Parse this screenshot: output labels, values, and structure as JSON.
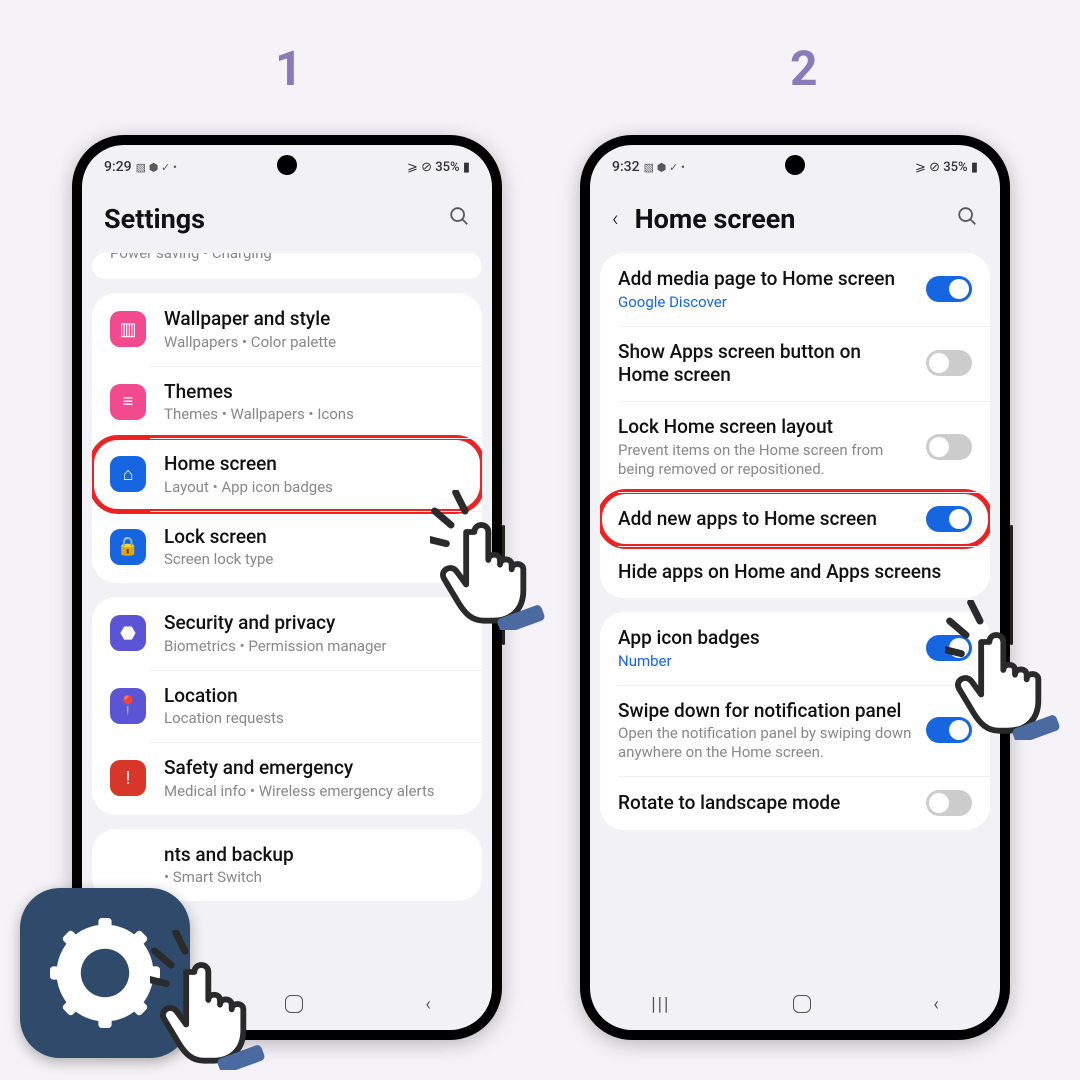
{
  "steps": {
    "one": "1",
    "two": "2"
  },
  "phone1": {
    "status": {
      "time": "9:29",
      "icons": "▧ ⬢ ✓ •",
      "right": "⩾ ⊘ 35% ▮"
    },
    "header": {
      "title": "Settings"
    },
    "faded": "Power saving  •  Charging",
    "items": [
      {
        "icon": "▥",
        "color": "pink",
        "title": "Wallpaper and style",
        "sub": "Wallpapers  •  Color palette"
      },
      {
        "icon": "≡",
        "color": "pink",
        "title": "Themes",
        "sub": "Themes  •  Wallpapers  •  Icons"
      },
      {
        "icon": "⌂",
        "color": "blue",
        "title": "Home screen",
        "sub": "Layout  •  App icon badges",
        "highlight": true
      },
      {
        "icon": "🔒",
        "color": "blue",
        "title": "Lock screen",
        "sub": "Screen lock type"
      }
    ],
    "items2": [
      {
        "icon": "⬣",
        "color": "purple",
        "title": "Security and privacy",
        "sub": "Biometrics  •  Permission manager"
      },
      {
        "icon": "📍",
        "color": "purple",
        "title": "Location",
        "sub": "Location requests"
      },
      {
        "icon": "!",
        "color": "red",
        "title": "Safety and emergency",
        "sub": "Medical info  •  Wireless emergency alerts"
      }
    ],
    "items3": [
      {
        "icon": "",
        "color": "",
        "title": "nts and backup",
        "sub": "•  Smart Switch"
      }
    ]
  },
  "phone2": {
    "status": {
      "time": "9:32",
      "icons": "▧ ⬢ ✓ •",
      "right": "⩾ ⊘ 35% ▮"
    },
    "header": {
      "title": "Home screen"
    },
    "rows": [
      {
        "title": "Add media page to Home screen",
        "sub": "Google Discover",
        "sublink": true,
        "toggle": "on"
      },
      {
        "title": "Show Apps screen button on Home screen",
        "toggle": "off"
      },
      {
        "title": "Lock Home screen layout",
        "sub": "Prevent items on the Home screen from being removed or repositioned.",
        "toggle": "off"
      },
      {
        "title": "Add new apps to Home screen",
        "toggle": "on",
        "highlight": true
      },
      {
        "title": "Hide apps on Home and Apps screens"
      }
    ],
    "rows2": [
      {
        "title": "App icon badges",
        "sub": "Number",
        "sublink": true,
        "toggle": "on"
      },
      {
        "title": "Swipe down for notification panel",
        "sub": "Open the notification panel by swiping down anywhere on the Home screen.",
        "toggle": "on"
      },
      {
        "title": "Rotate to landscape mode",
        "toggle": "off"
      }
    ]
  }
}
